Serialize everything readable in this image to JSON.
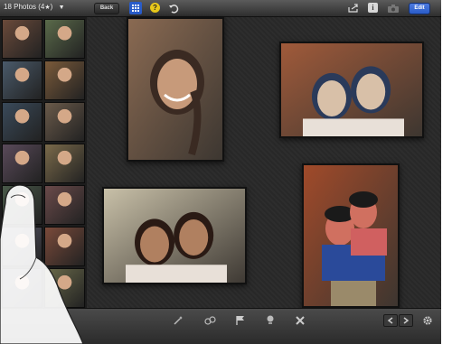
{
  "toolbar": {
    "album_title": "18 Photos (4",
    "album_suffix": ")",
    "back_label": "Back",
    "edit_label": "Edit",
    "icons": [
      "grid-view-icon",
      "help-icon",
      "undo-icon",
      "share-icon",
      "info-icon",
      "camera-icon"
    ]
  },
  "bottombar": {
    "icons": [
      "magic-wand-icon",
      "flag-icon",
      "pin-icon",
      "cancel-icon",
      "prev-arrow-icon",
      "next-arrow-icon",
      "gear-icon"
    ]
  },
  "strip": {
    "thumb_count": 14
  },
  "photos": [
    {
      "name": "photo-woman-braid",
      "palette": [
        "#8a6a52",
        "#c79a7a",
        "#3a2a22"
      ]
    },
    {
      "name": "photo-couple-wall",
      "palette": [
        "#a05a3a",
        "#d8c0a8",
        "#2a3a5a"
      ]
    },
    {
      "name": "photo-two-women",
      "palette": [
        "#c8c0a8",
        "#b08060",
        "#2a1a14"
      ]
    },
    {
      "name": "photo-couple-piggyback",
      "palette": [
        "#a04a2a",
        "#d07060",
        "#3a4a8a"
      ]
    }
  ],
  "colors": {
    "accent": "#2a5cc8",
    "help": "#e8c81a"
  }
}
